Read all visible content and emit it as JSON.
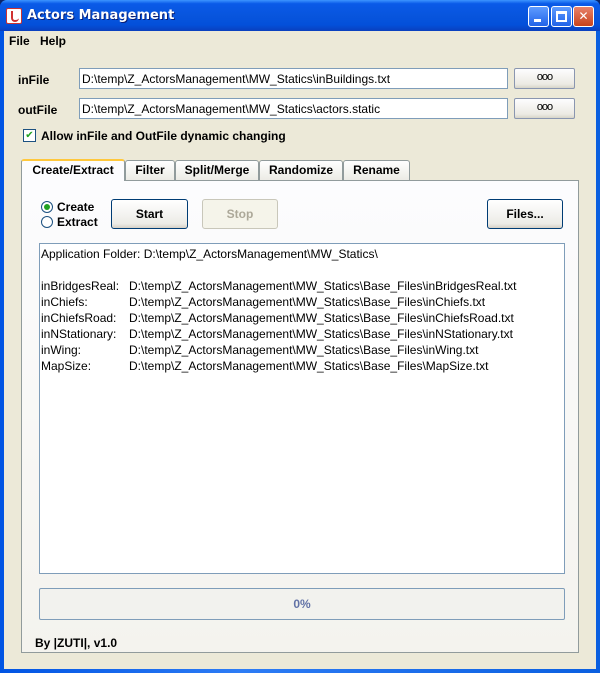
{
  "window": {
    "title": "Actors Management"
  },
  "menu": {
    "items": [
      "File",
      "Help"
    ]
  },
  "fields": {
    "infile": {
      "label": "inFile",
      "value": "D:\\temp\\Z_ActorsManagement\\MW_Statics\\inBuildings.txt",
      "browse_label": "ooo"
    },
    "outfile": {
      "label": "outFile",
      "value": "D:\\temp\\Z_ActorsManagement\\MW_Statics\\actors.static",
      "browse_label": "ooo"
    }
  },
  "dynamic_change": {
    "label": "Allow inFile and OutFile dynamic changing",
    "checked": true
  },
  "tabs": [
    {
      "label": "Create/Extract",
      "active": true
    },
    {
      "label": "Filter",
      "active": false
    },
    {
      "label": "Split/Merge",
      "active": false
    },
    {
      "label": "Randomize",
      "active": false
    },
    {
      "label": "Rename",
      "active": false
    }
  ],
  "mode": {
    "options": [
      {
        "label": "Create",
        "selected": true
      },
      {
        "label": "Extract",
        "selected": false
      }
    ]
  },
  "buttons": {
    "start": "Start",
    "stop": "Stop",
    "files": "Files..."
  },
  "log": {
    "app_folder": "Application Folder: D:\\temp\\Z_ActorsManagement\\MW_Statics\\",
    "entries": [
      {
        "key": "inBridgesReal:",
        "value": "D:\\temp\\Z_ActorsManagement\\MW_Statics\\Base_Files\\inBridgesReal.txt"
      },
      {
        "key": "inChiefs:",
        "value": "D:\\temp\\Z_ActorsManagement\\MW_Statics\\Base_Files\\inChiefs.txt"
      },
      {
        "key": "inChiefsRoad:",
        "value": "D:\\temp\\Z_ActorsManagement\\MW_Statics\\Base_Files\\inChiefsRoad.txt"
      },
      {
        "key": "inNStationary:",
        "value": "D:\\temp\\Z_ActorsManagement\\MW_Statics\\Base_Files\\inNStationary.txt"
      },
      {
        "key": "inWing:",
        "value": "D:\\temp\\Z_ActorsManagement\\MW_Statics\\Base_Files\\inWing.txt"
      },
      {
        "key": "MapSize:",
        "value": "D:\\temp\\Z_ActorsManagement\\MW_Statics\\Base_Files\\MapSize.txt"
      }
    ]
  },
  "progress": {
    "text": "0%",
    "fraction": 0
  },
  "footer": {
    "text": "By |ZUTI|, v1.0"
  },
  "colors": {
    "title_bar": "#0855dd",
    "panel_bg": "#ece9d8",
    "tab_highlight": "#ffc83c",
    "progress_text": "#6272a6"
  }
}
